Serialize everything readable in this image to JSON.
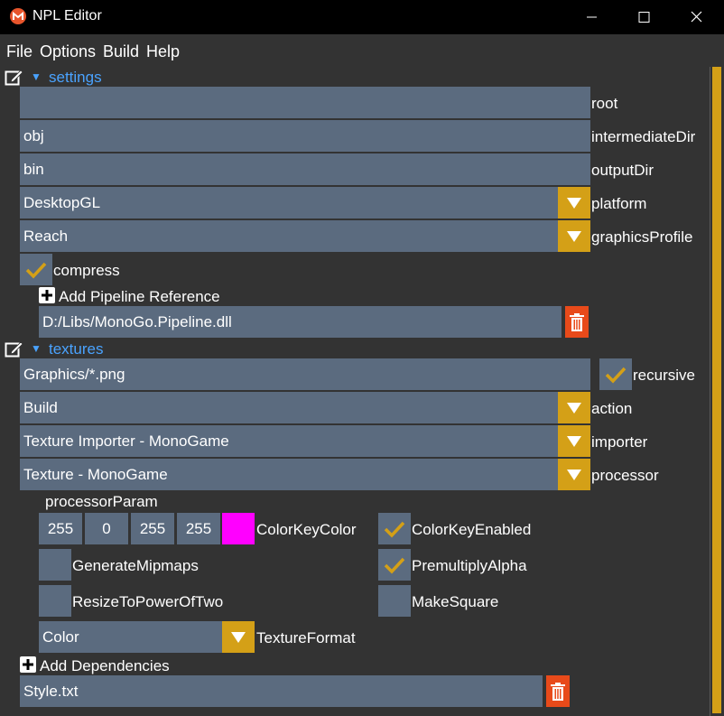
{
  "window": {
    "title": "NPL Editor",
    "minimize_icon": "minimize-icon",
    "maximize_icon": "maximize-icon",
    "close_icon": "close-icon"
  },
  "menu": {
    "file": "File",
    "options": "Options",
    "build": "Build",
    "help": "Help"
  },
  "settings": {
    "title": "settings",
    "root": {
      "label": "root",
      "value": ""
    },
    "intermediateDir": {
      "label": "intermediateDir",
      "value": "obj"
    },
    "outputDir": {
      "label": "outputDir",
      "value": "bin"
    },
    "platform": {
      "label": "platform",
      "value": "DesktopGL"
    },
    "graphicsProfile": {
      "label": "graphicsProfile",
      "value": "Reach"
    },
    "compress": {
      "label": "compress",
      "checked": true
    },
    "add_reference": "Add Pipeline Reference",
    "reference": "D:/Libs/MonoGo.Pipeline.dll"
  },
  "textures": {
    "title": "textures",
    "path": "Graphics/*.png",
    "recursive": {
      "label": "recursive",
      "checked": true
    },
    "action": {
      "label": "action",
      "value": "Build"
    },
    "importer": {
      "label": "importer",
      "value": "Texture Importer - MonoGame"
    },
    "processor": {
      "label": "processor",
      "value": "Texture - MonoGame"
    },
    "processorParam": "processorParam",
    "colorKey": {
      "label": "ColorKeyColor",
      "r": "255",
      "g": "0",
      "b": "255",
      "a": "255",
      "swatch": "#ff00ff"
    },
    "colorKeyEnabled": {
      "label": "ColorKeyEnabled",
      "checked": true
    },
    "generateMipmaps": {
      "label": "GenerateMipmaps",
      "checked": false
    },
    "premultiplyAlpha": {
      "label": "PremultiplyAlpha",
      "checked": true
    },
    "resizeToPowerOfTwo": {
      "label": "ResizeToPowerOfTwo",
      "checked": false
    },
    "makeSquare": {
      "label": "MakeSquare",
      "checked": false
    },
    "textureFormat": {
      "label": "TextureFormat",
      "value": "Color"
    },
    "add_dependencies": "Add Dependencies",
    "dependency": "Style.txt"
  },
  "colors": {
    "accent": "#d4a017",
    "field": "#5b6b7f",
    "link": "#4aa3ff",
    "delete": "#e84a1a",
    "background": "#333333"
  }
}
